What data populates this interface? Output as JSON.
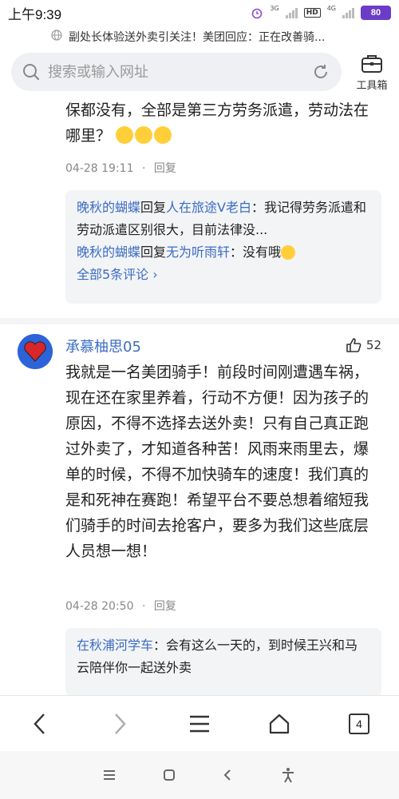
{
  "status": {
    "time": "上午9:39",
    "net1": "3G",
    "hd": "HD",
    "net2": "4G",
    "battery": "80"
  },
  "page_title": "副处长体验送外卖引关注！美团回应：正在改善骑...",
  "search": {
    "placeholder": "搜索或输入网址"
  },
  "toolbox_label": "工具箱",
  "comment1": {
    "text": "保都没有，全部是第三方劳务派遣，劳动法在哪里？",
    "date": "04-28 19:11",
    "reply": "回复",
    "replies": [
      {
        "user": "晚秋的蝴蝶",
        "verb": "回复",
        "target": "人在旅途V老白",
        "text": "：我记得劳务派遣和劳动派遣区别很大，目前法律没..."
      },
      {
        "user": "晚秋的蝴蝶",
        "verb": "回复",
        "target": "无为听雨轩",
        "text": "：没有哦"
      }
    ],
    "all_label": "全部5条评论 ›"
  },
  "comment2": {
    "user": "承慕柚思05",
    "likes": "52",
    "text": "我就是一名美团骑手！前段时间刚遭遇车祸，现在还在家里养着，行动不方便！因为孩子的原因，不得不选择去送外卖！只有自己真正跑过外卖了，才知道各种苦！风雨来雨里去，爆单的时候，不得不加快骑车的速度！我们真的是和死神在赛跑！希望平台不要总想着缩短我们骑手的时间去抢客户，要多为我们这些底层人员想一想！",
    "date": "04-28 20:50",
    "reply": "回复",
    "replies": [
      {
        "user": "在秋浦河学车",
        "text": "：会有这么一天的，到时候王兴和马云陪伴你一起送外卖"
      }
    ]
  },
  "nav": {
    "tab_count": "4"
  },
  "colors": {
    "link": "#3b6cc4",
    "battery": "#6a3cc7"
  }
}
